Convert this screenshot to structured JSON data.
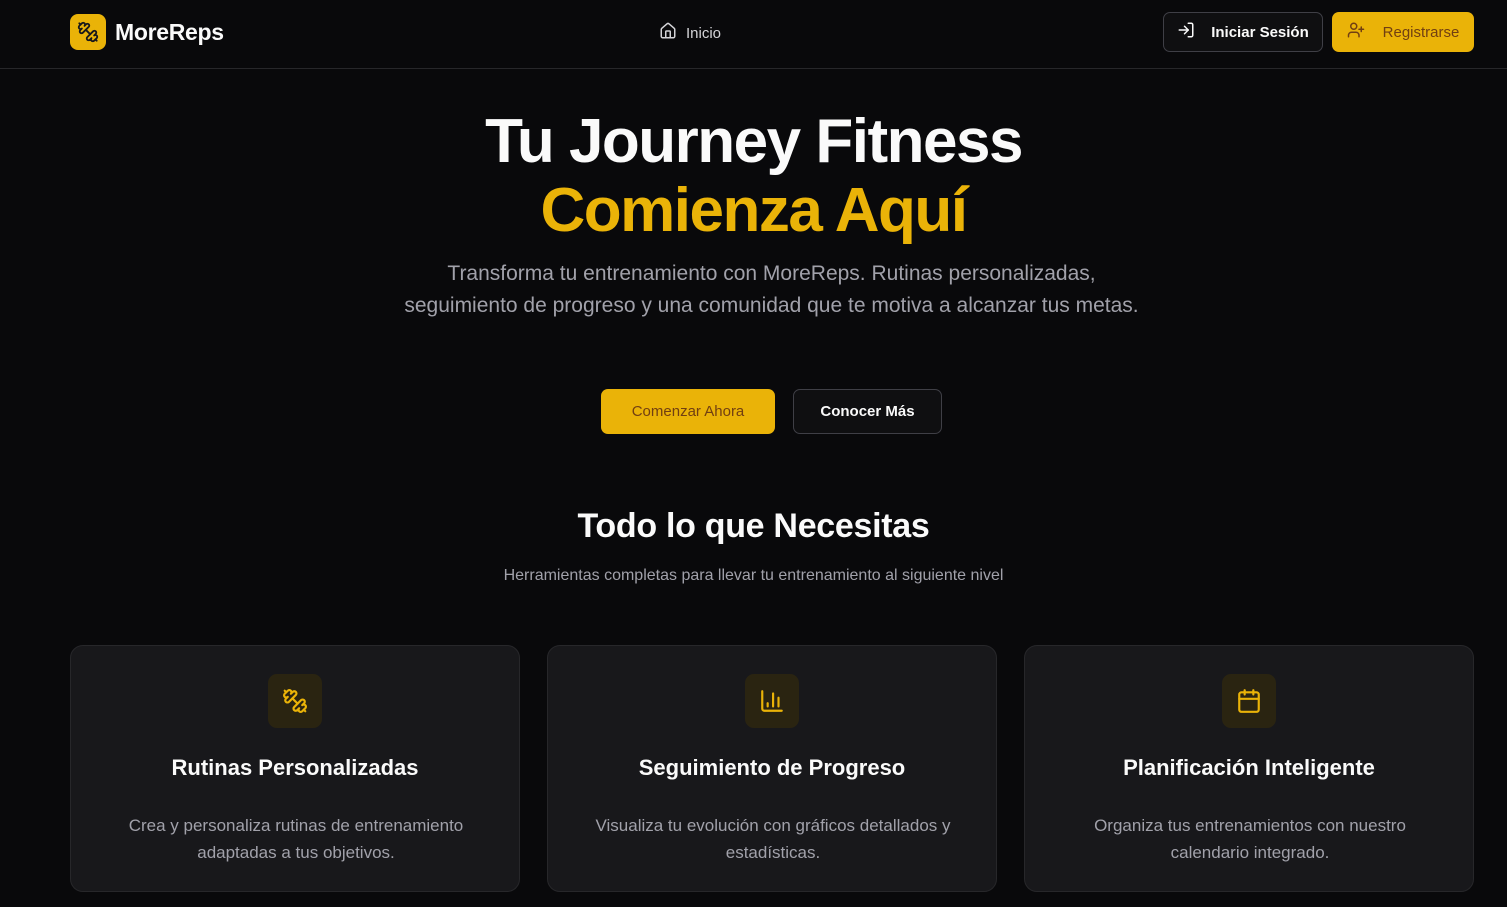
{
  "header": {
    "brand_name": "MoreReps",
    "nav_home_label": "Inicio",
    "login_label": "Iniciar Sesión",
    "register_label": "Registrarse"
  },
  "hero": {
    "title_line1": "Tu Journey Fitness",
    "title_line2": "Comienza Aquí",
    "subtitle": "Transforma tu entrenamiento con MoreReps. Rutinas personalizadas, seguimiento de progreso y una comunidad que te motiva a alcanzar tus metas.",
    "primary_cta": "Comenzar Ahora",
    "secondary_cta": "Conocer Más"
  },
  "features": {
    "title": "Todo lo que Necesitas",
    "subtitle": "Herramientas completas para llevar tu entrenamiento al siguiente nivel",
    "cards": [
      {
        "icon": "dumbbell-icon",
        "title": "Rutinas Personalizadas",
        "description": "Crea y personaliza rutinas de entrenamiento adaptadas a tus objetivos."
      },
      {
        "icon": "bar-chart-icon",
        "title": "Seguimiento de Progreso",
        "description": "Visualiza tu evolución con gráficos detallados y estadísticas."
      },
      {
        "icon": "calendar-icon",
        "title": "Planificación Inteligente",
        "description": "Organiza tus entrenamientos con nuestro calendario integrado."
      }
    ]
  },
  "colors": {
    "accent": "#eab308",
    "background": "#09090b",
    "card": "#18181b",
    "muted_text": "#a1a1aa"
  }
}
